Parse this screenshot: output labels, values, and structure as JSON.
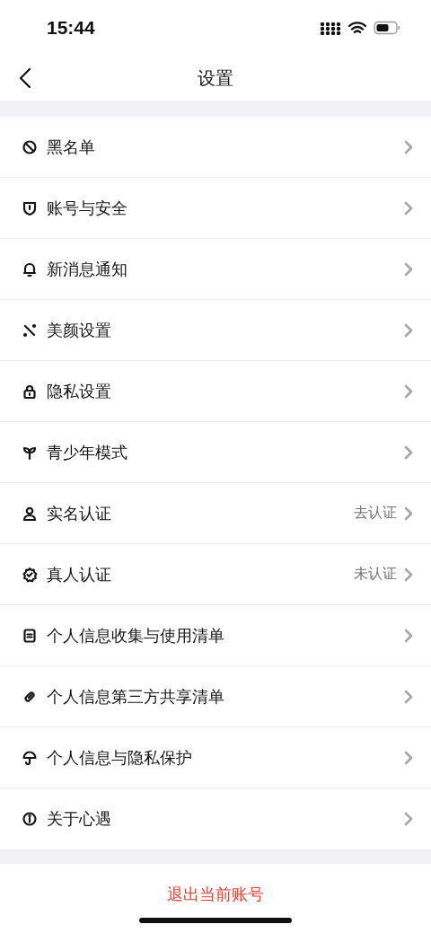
{
  "status_bar": {
    "time": "15:44"
  },
  "nav": {
    "title": "设置"
  },
  "items": [
    {
      "label": "黑名单"
    },
    {
      "label": "账号与安全"
    },
    {
      "label": "新消息通知"
    },
    {
      "label": "美颜设置"
    },
    {
      "label": "隐私设置"
    },
    {
      "label": "青少年模式"
    },
    {
      "label": "实名认证",
      "value": "去认证"
    },
    {
      "label": "真人认证",
      "value": "未认证"
    },
    {
      "label": "个人信息收集与使用清单"
    },
    {
      "label": "个人信息第三方共享清单"
    },
    {
      "label": "个人信息与隐私保护"
    },
    {
      "label": "关于心遇"
    }
  ],
  "logout": "退出当前账号"
}
